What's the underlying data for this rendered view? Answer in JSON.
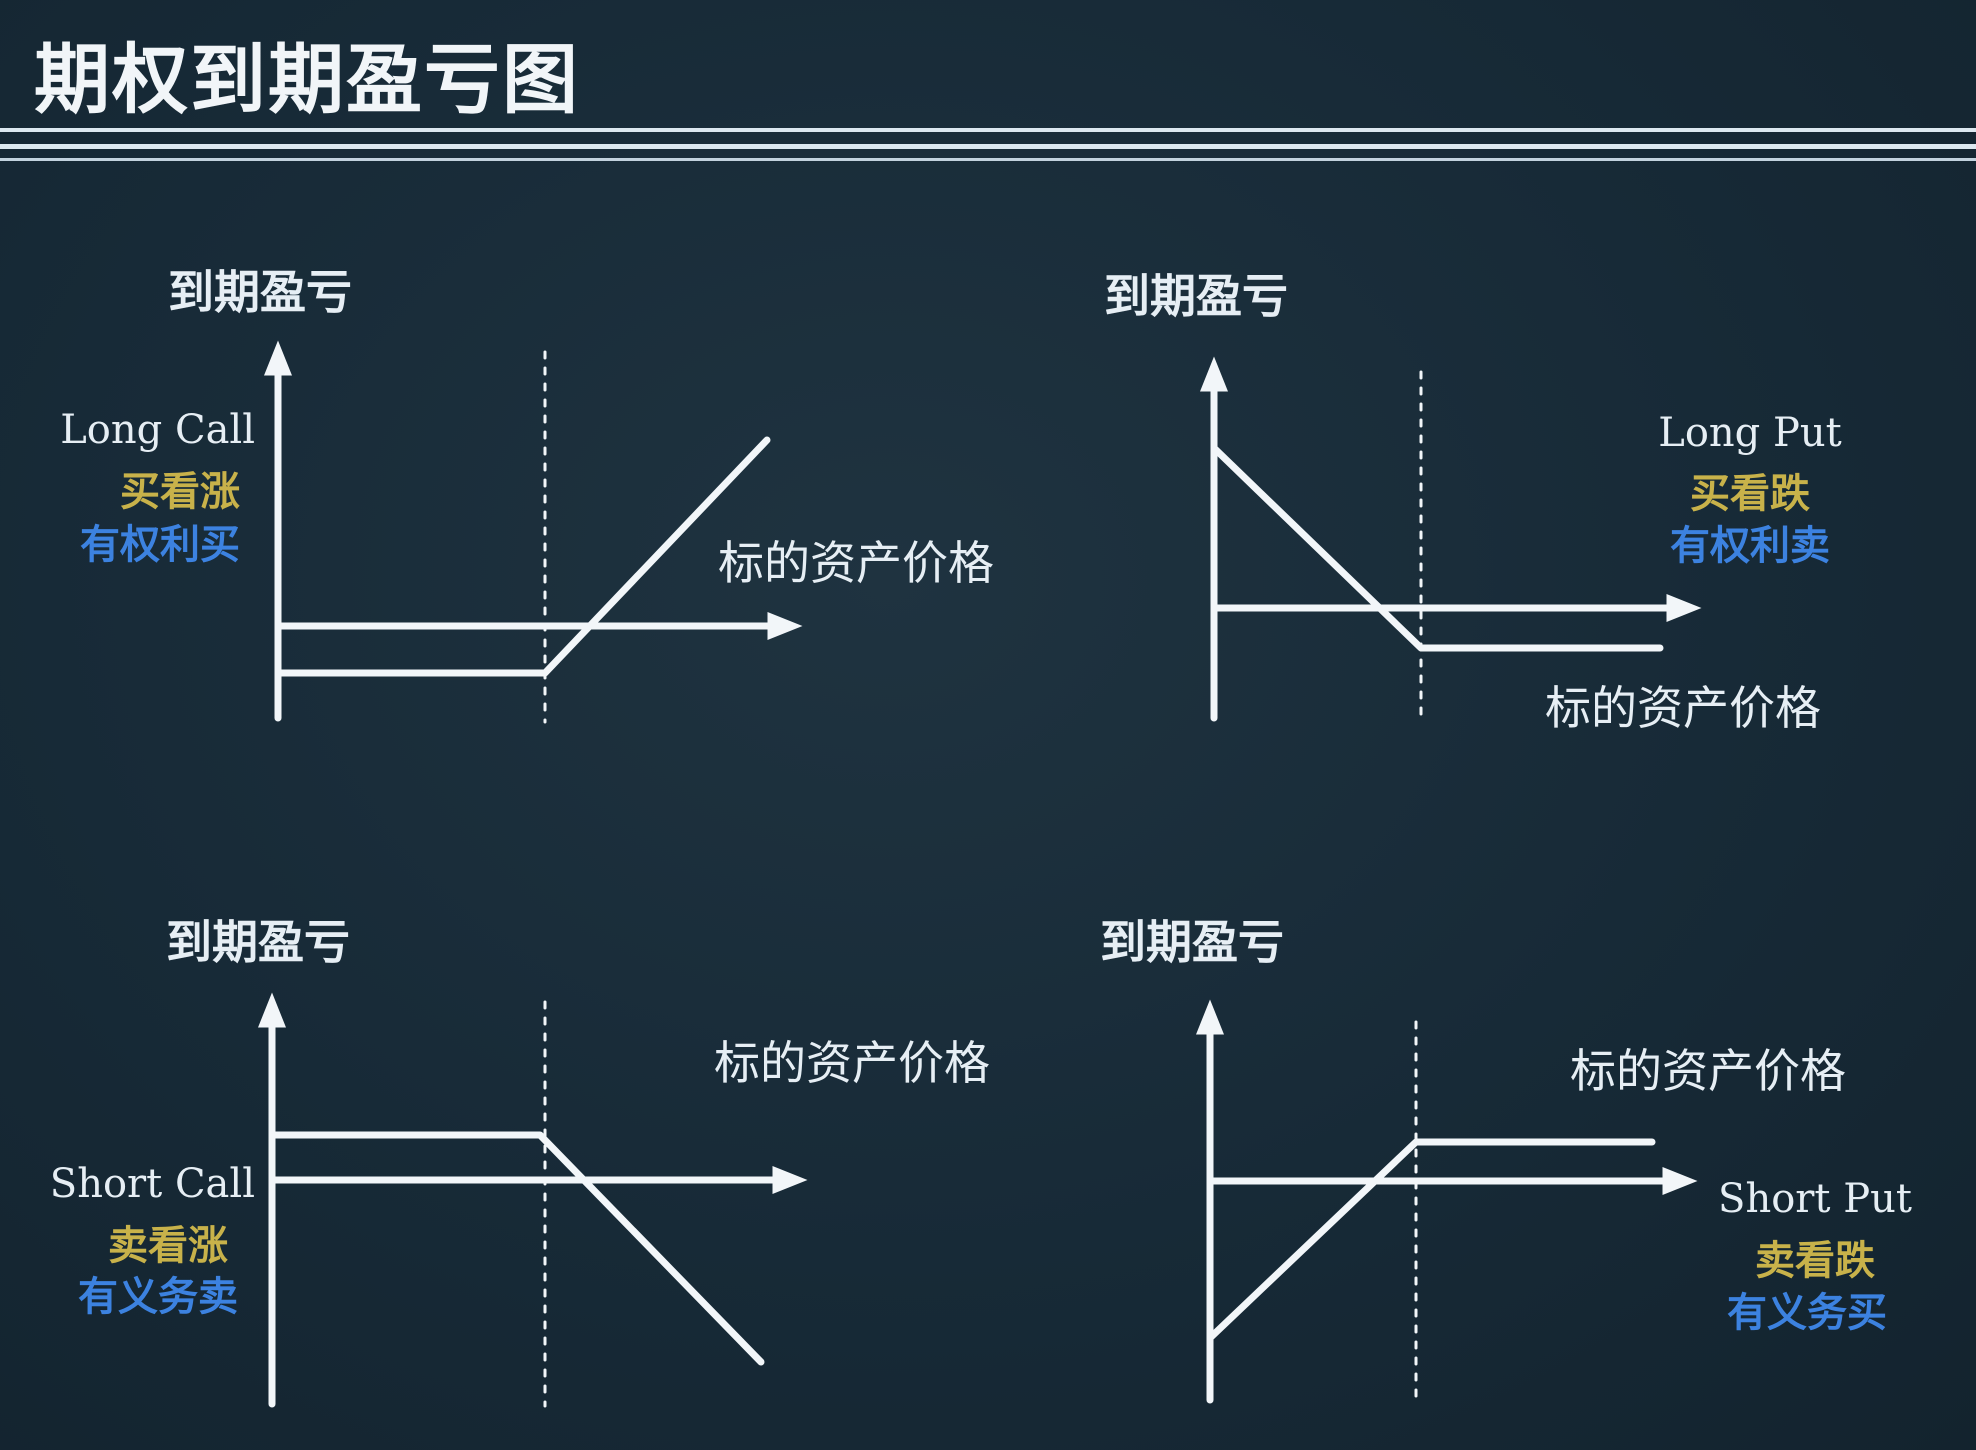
{
  "title": "期权到期盈亏图",
  "colors": {
    "background": "#172a37",
    "line": "#f2f6f9",
    "accent_yellow": "#c8b24a",
    "accent_blue": "#3c82e0"
  },
  "panels": {
    "long_call": {
      "ylabel": "到期盈亏",
      "xlabel": "标的资产价格",
      "name_en": "Long Call",
      "name_zh": "买看涨",
      "desc": "有权利买"
    },
    "long_put": {
      "ylabel": "到期盈亏",
      "xlabel": "标的资产价格",
      "name_en": "Long Put",
      "name_zh": "买看跌",
      "desc": "有权利卖"
    },
    "short_call": {
      "ylabel": "到期盈亏",
      "xlabel": "标的资产价格",
      "name_en": "Short Call",
      "name_zh": "卖看涨",
      "desc": "有义务卖"
    },
    "short_put": {
      "ylabel": "到期盈亏",
      "xlabel": "标的资产价格",
      "name_en": "Short Put",
      "name_zh": "卖看跌",
      "desc": "有义务买"
    }
  }
}
